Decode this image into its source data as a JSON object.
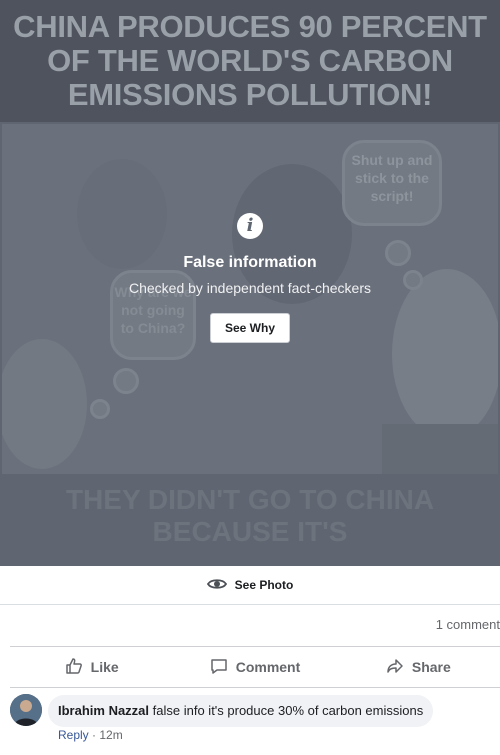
{
  "post": {
    "meme_title": "CHINA PRODUCES 90 PERCENT OF THE WORLD'S CARBON EMISSIONS POLLUTION!",
    "bubble_1": "Shut up and stick to the script!",
    "bubble_2": "Why are we not going to China?",
    "faint_caption": "THEY DIDN'T GO TO CHINA BECAUSE IT'S",
    "overlay": {
      "icon": "info-icon",
      "title": "False information",
      "subtitle": "Checked by independent fact-checkers",
      "button": "See Why"
    },
    "see_photo": "See Photo",
    "comment_count": "1 comment"
  },
  "actions": {
    "like": "Like",
    "comment": "Comment",
    "share": "Share"
  },
  "comment": {
    "author": "Ibrahim Nazzal",
    "text": "false info it's produce 30% of carbon emissions",
    "reply": "Reply",
    "separator": "·",
    "time": "12m"
  },
  "colors": {
    "overlay_bg": "#5f6672",
    "link": "#385898",
    "muted": "#65676b"
  }
}
